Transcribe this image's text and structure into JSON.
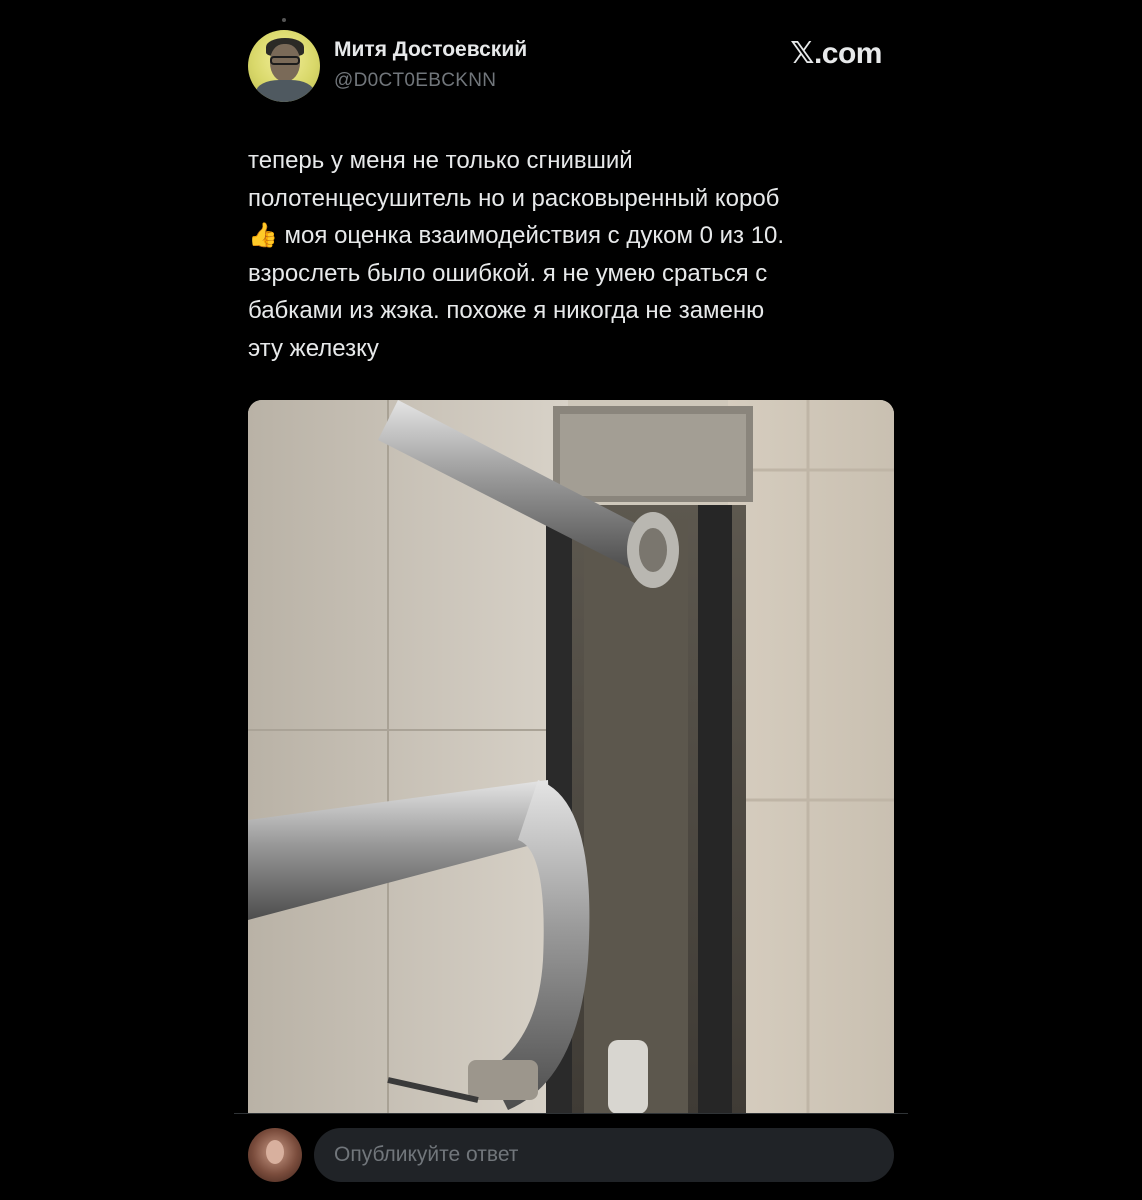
{
  "author": {
    "name": "Митя Достоевский",
    "handle": "@D0CT0EBCKNN"
  },
  "brand": "𝕏.com",
  "tweet": {
    "text": "теперь у меня не только сгнивший\nполотенцесушитель но и расковыренный короб\n👍 моя оценка взаимодействия с дуком 0 из 10.\nвзрослеть было ошибкой. я не умею сраться с\nбабками из жэка. похоже я никогда не заменю\nэту железку"
  },
  "reply": {
    "placeholder": "Опубликуйте ответ"
  },
  "colors": {
    "background": "#000000",
    "text": "#e7e9ea",
    "secondary_text": "#71767b",
    "input_bg": "#202327"
  }
}
